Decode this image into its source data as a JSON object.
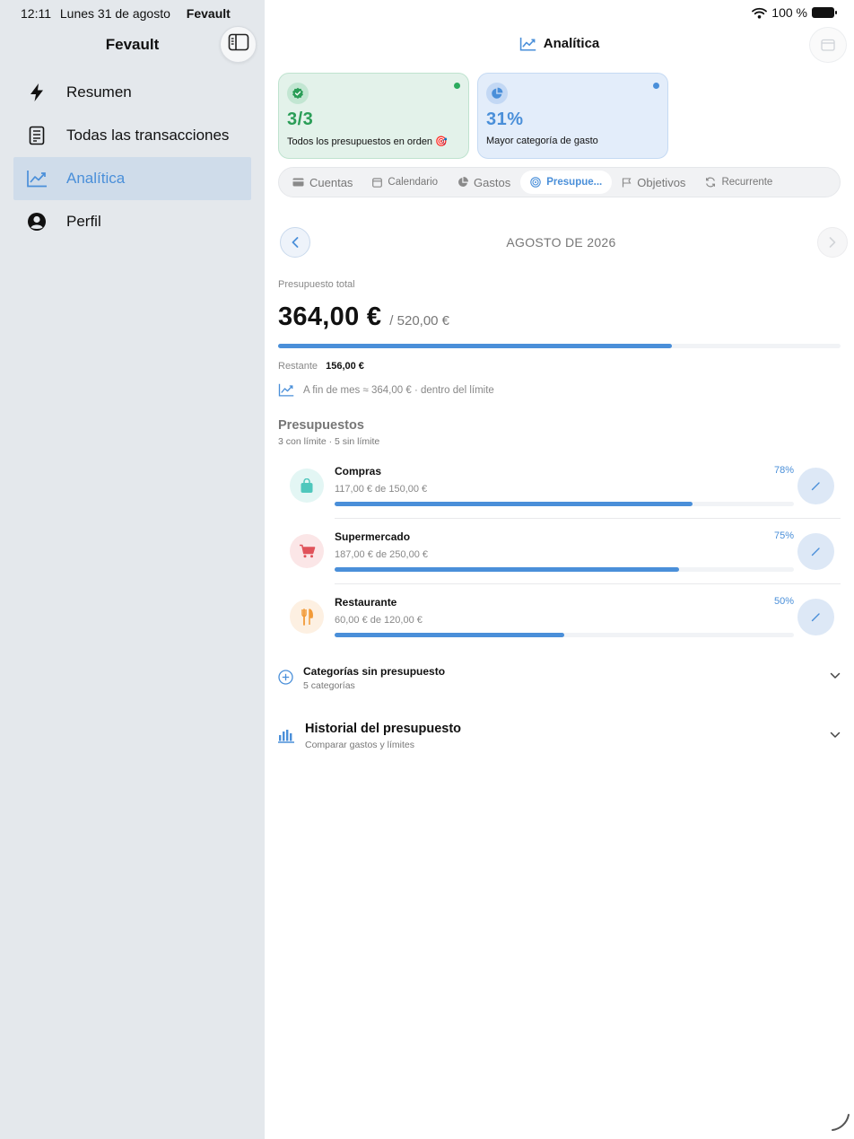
{
  "status_bar": {
    "time": "12:11",
    "date": "Lunes 31 de agosto",
    "app_name": "Fevault",
    "battery": "100 %"
  },
  "sidebar": {
    "title": "Fevault",
    "toggle_icon": "sidebar-toggle-icon",
    "items": [
      {
        "label": "Resumen",
        "icon": "bolt-icon",
        "active": false
      },
      {
        "label": "Todas las transacciones",
        "icon": "receipt-icon",
        "active": false
      },
      {
        "label": "Analítica",
        "icon": "chart-line-icon",
        "active": true
      },
      {
        "label": "Perfil",
        "icon": "person-circle-icon",
        "active": false
      }
    ]
  },
  "header": {
    "title": "Analítica",
    "icon": "chart-line-icon",
    "calendar_icon": "calendar-icon"
  },
  "summary_cards": [
    {
      "value": "3/3",
      "label": "Todos los presupuestos en orden 🎯",
      "icon": "check-badge-icon",
      "color": "#2a9d57"
    },
    {
      "value": "31%",
      "label": "Mayor categoría de gasto",
      "icon": "pie-chart-icon",
      "color": "#4a8fd9"
    }
  ],
  "tabs": [
    {
      "label": "Cuentas",
      "icon": "card-icon",
      "active": false
    },
    {
      "label": "Calendario",
      "icon": "calendar-icon",
      "active": false
    },
    {
      "label": "Gastos",
      "icon": "pie-icon",
      "active": false
    },
    {
      "label": "Presupue...",
      "icon": "target-icon",
      "active": true
    },
    {
      "label": "Objetivos",
      "icon": "flag-icon",
      "active": false
    },
    {
      "label": "Recurrente",
      "icon": "refresh-icon",
      "active": false
    }
  ],
  "month": {
    "label": "AGOSTO DE 2026"
  },
  "total": {
    "label": "Presupuesto total",
    "amount": "364,00 €",
    "limit": "/ 520,00 €",
    "progress": 0.7,
    "remaining_label": "Restante",
    "remaining_value": "156,00 €",
    "forecast": "A fin de mes ≈ 364,00 € · dentro del límite"
  },
  "budgets": {
    "title": "Presupuestos",
    "subtitle": "3 con límite · 5 sin límite",
    "items": [
      {
        "name": "Compras",
        "amount": "117,00 € de 150,00 €",
        "percent": "78%",
        "progress": 0.78,
        "icon": "shopping-bag-icon",
        "color": "#4fc7bc",
        "bg": "#e3f6f4"
      },
      {
        "name": "Supermercado",
        "amount": "187,00 € de 250,00 €",
        "percent": "75%",
        "progress": 0.75,
        "icon": "cart-icon",
        "color": "#e0525a",
        "bg": "#fbe6e7"
      },
      {
        "name": "Restaurante",
        "amount": "60,00 € de 120,00 €",
        "percent": "50%",
        "progress": 0.5,
        "icon": "fork-knife-icon",
        "color": "#f29a38",
        "bg": "#fdf0e2"
      }
    ]
  },
  "uncategorized": {
    "title": "Categorías sin presupuesto",
    "subtitle": "5 categorías",
    "icon": "plus-circle-icon"
  },
  "history": {
    "title": "Historial del presupuesto",
    "subtitle": "Comparar gastos y límites",
    "icon": "bar-chart-icon"
  },
  "colors": {
    "accent": "#4a8fd9",
    "success": "#2a9d57",
    "sidebar_bg": "#e4e8ec"
  }
}
